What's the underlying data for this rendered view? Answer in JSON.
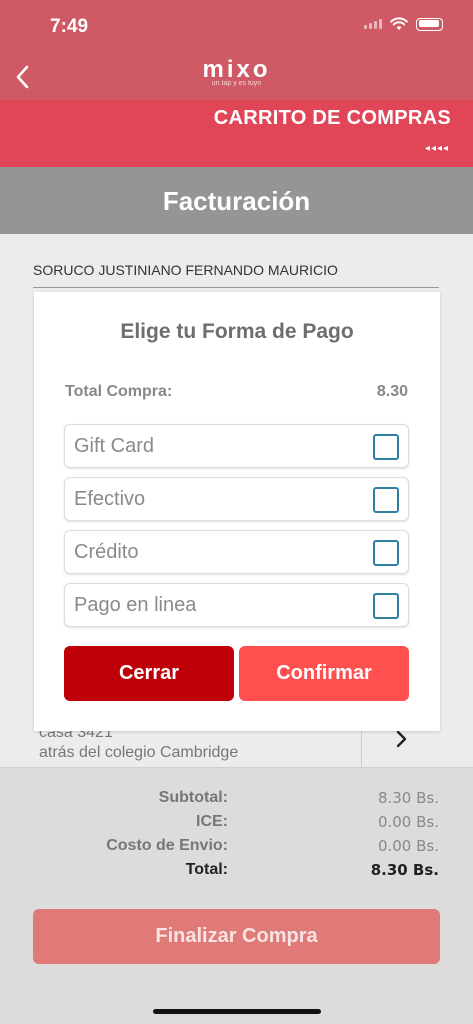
{
  "status_bar": {
    "time": "7:49"
  },
  "header": {
    "logo": "mixo",
    "logo_tagline": "un tap y es tuyo",
    "cart_title": "CARRITO DE COMPRAS",
    "cart_arrows": "◂◂◂◂"
  },
  "section": {
    "title": "Facturación"
  },
  "customer": {
    "name": "SORUCO JUSTINIANO FERNANDO MAURICIO"
  },
  "address": {
    "line1": "casa 3421",
    "line2": "atrás del colegio Cambridge"
  },
  "totals": {
    "rows": [
      {
        "label": "Subtotal:",
        "value": "8.30 Bs."
      },
      {
        "label": "ICE:",
        "value": "0.00 Bs."
      },
      {
        "label": "Costo de Envio:",
        "value": "0.00 Bs."
      },
      {
        "label": "Total:",
        "value": "8.30 Bs."
      }
    ]
  },
  "finalize_button": "Finalizar Compra",
  "modal": {
    "title": "Elige tu Forma de Pago",
    "total_label": "Total Compra:",
    "total_value": "8.30",
    "options": [
      {
        "label": "Gift Card",
        "checked": false
      },
      {
        "label": "Efectivo",
        "checked": false
      },
      {
        "label": "Crédito",
        "checked": false
      },
      {
        "label": "Pago en linea",
        "checked": false
      }
    ],
    "close_button": "Cerrar",
    "confirm_button": "Confirmar"
  },
  "colors": {
    "header": "#cf5a66",
    "cart_bar": "#e04558",
    "billing_bar": "#959595",
    "close_button": "#c00008",
    "confirm_button": "#ff4f4f",
    "finalize_button": "#e07a78",
    "checkbox_border": "#2f7fa3"
  }
}
